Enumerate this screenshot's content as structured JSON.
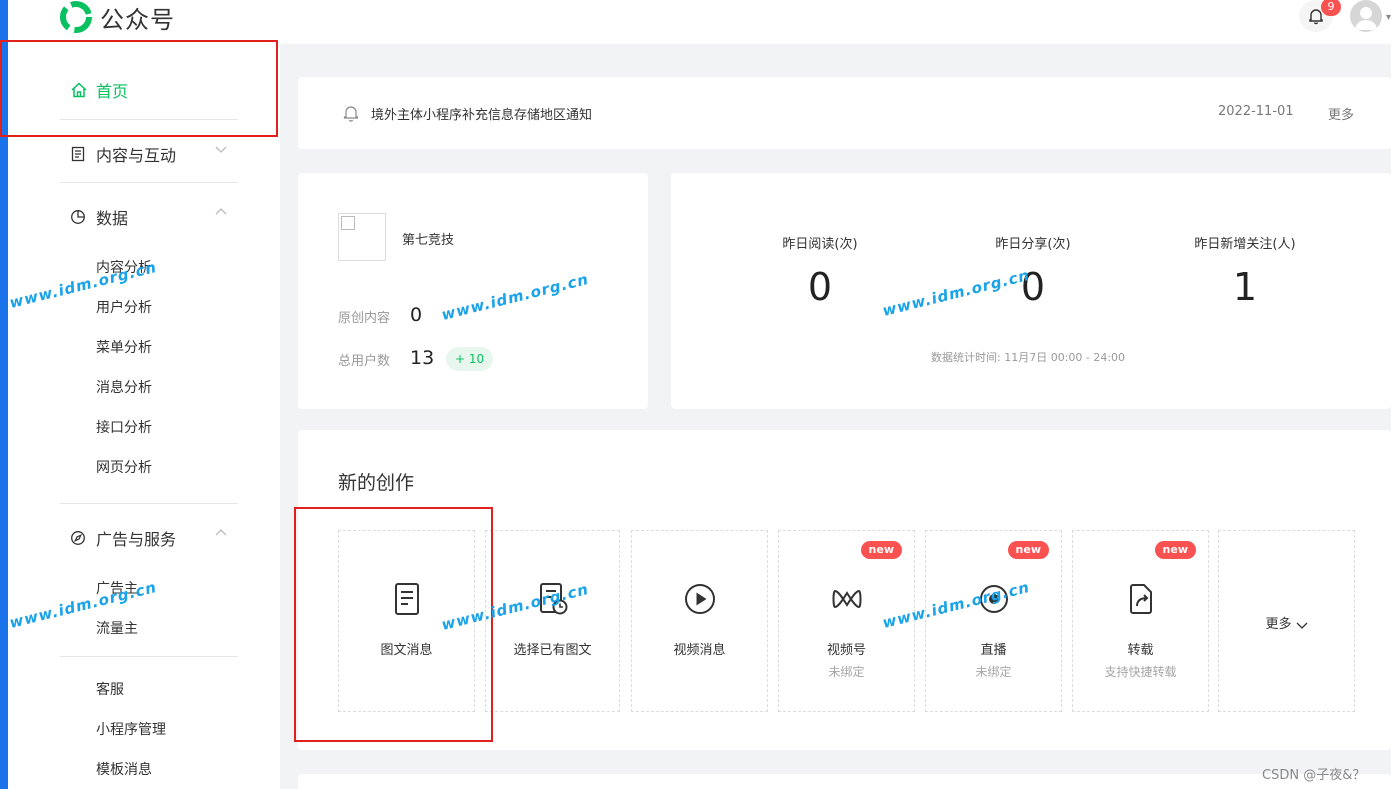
{
  "header": {
    "app_name": "公众号",
    "notification_count": "9"
  },
  "sidebar": {
    "home": "首页",
    "groups": [
      {
        "label": "内容与互动",
        "expanded": false
      },
      {
        "label": "数据",
        "expanded": true,
        "items": [
          "内容分析",
          "用户分析",
          "菜单分析",
          "消息分析",
          "接口分析",
          "网页分析"
        ]
      },
      {
        "label": "广告与服务",
        "expanded": true,
        "items": [
          "广告主",
          "流量主"
        ]
      }
    ],
    "extra_items": [
      "客服",
      "小程序管理",
      "模板消息"
    ]
  },
  "notice": {
    "text": "境外主体小程序补充信息存储地区通知",
    "date": "2022-11-01",
    "more": "更多"
  },
  "account": {
    "name": "第七竞技",
    "original_label": "原创内容",
    "original_value": "0",
    "users_label": "总用户数",
    "users_value": "13",
    "users_delta": "+ 10"
  },
  "metrics": [
    {
      "label": "昨日阅读(次)",
      "value": "0"
    },
    {
      "label": "昨日分享(次)",
      "value": "0"
    },
    {
      "label": "昨日新增关注(人)",
      "value": "1"
    }
  ],
  "metrics_note": "数据统计时间: 11月7日 00:00 - 24:00",
  "creation": {
    "title": "新的创作",
    "tiles": [
      {
        "label": "图文消息",
        "icon": "article-icon"
      },
      {
        "label": "选择已有图文",
        "icon": "existing-article-icon"
      },
      {
        "label": "视频消息",
        "icon": "play-icon"
      },
      {
        "label": "视频号",
        "sub": "未绑定",
        "badge": "new",
        "icon": "channels-icon"
      },
      {
        "label": "直播",
        "sub": "未绑定",
        "badge": "new",
        "icon": "live-icon"
      },
      {
        "label": "转载",
        "sub": "支持快捷转载",
        "badge": "new",
        "icon": "repost-icon"
      }
    ],
    "more": "更多"
  },
  "watermark": "www.idm.org.cn",
  "footer_credit": "CSDN @子夜&？",
  "colors": {
    "brand_green": "#07c160",
    "highlight_red": "#e0201c",
    "badge_red": "#fa5151",
    "watermark_blue": "#1aa3e8"
  }
}
